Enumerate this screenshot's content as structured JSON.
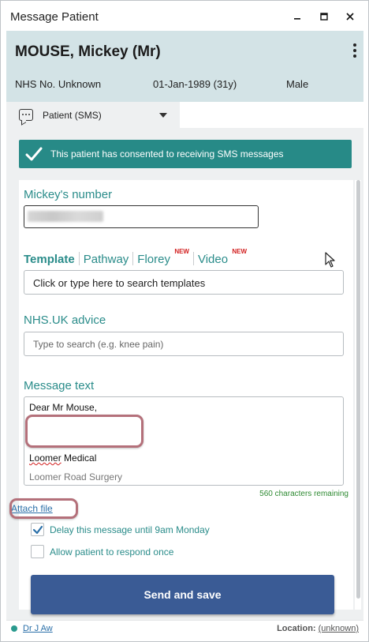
{
  "window": {
    "title": "Message Patient"
  },
  "patient": {
    "name": "MOUSE, Mickey (Mr)",
    "nhs": "NHS No. Unknown",
    "dob": "01-Jan-1989 (31y)",
    "sex": "Male"
  },
  "tab": {
    "label": "Patient (SMS)"
  },
  "consent": {
    "text": "This patient has consented to receiving SMS messages"
  },
  "number": {
    "label": "Mickey's number"
  },
  "templates": {
    "tabs": [
      "Template",
      "Pathway",
      "Florey",
      "Video"
    ],
    "new_badge": "NEW",
    "placeholder": "Click or type here to search templates"
  },
  "nhs_advice": {
    "label": "NHS.UK advice",
    "placeholder": "Type to search (e.g. knee pain)"
  },
  "message": {
    "label": "Message text",
    "greeting": "Dear Mr Mouse,",
    "sender_prefix": "Loomer",
    "sender_suffix": " Medical",
    "signature": "Loomer Road Surgery",
    "remaining": "560 characters remaining"
  },
  "attach": {
    "label": "Attach file"
  },
  "options": {
    "delay": {
      "label": "Delay this message until 9am Monday",
      "checked": true
    },
    "respond": {
      "label": "Allow patient to respond once",
      "checked": false
    }
  },
  "send": {
    "label": "Send and save"
  },
  "footer": {
    "user": "Dr J Aw",
    "location_label": "Location:",
    "location_value": "(unknown)"
  },
  "colors": {
    "accent_teal": "#2a8c8a",
    "consent_bg": "#278a87",
    "send_bg": "#3a5b95",
    "new_badge": "#d21f1f",
    "highlight": "#b4707a"
  }
}
